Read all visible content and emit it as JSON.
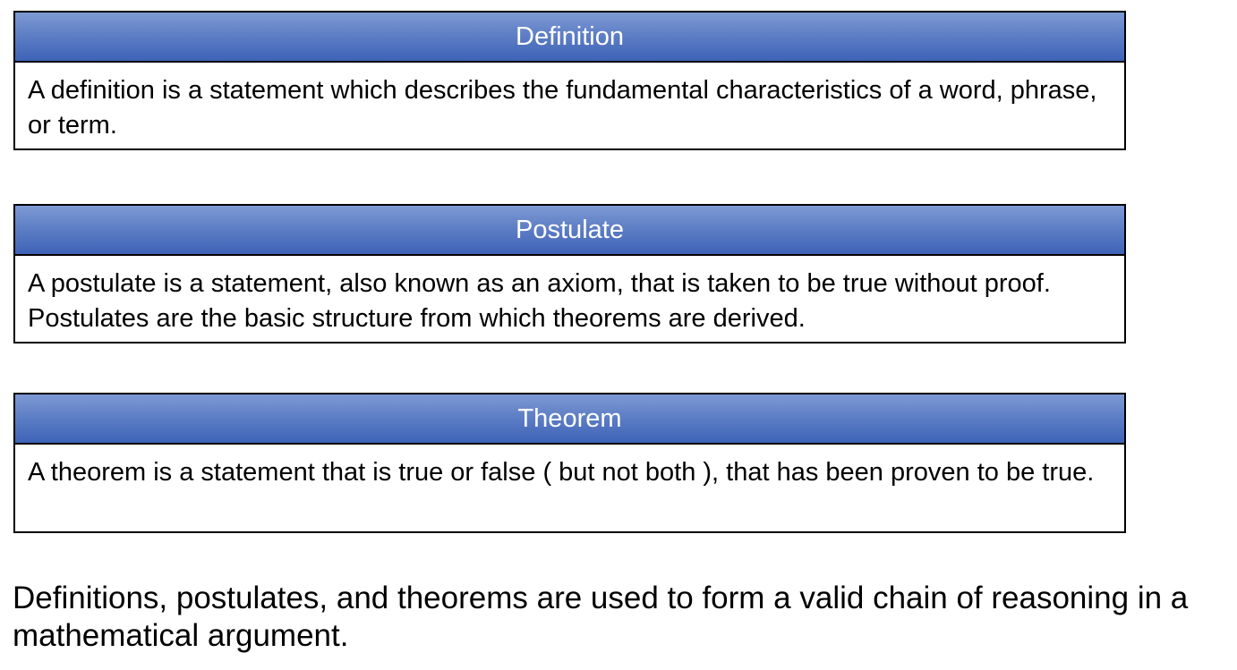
{
  "cards": [
    {
      "title": "Definition",
      "body": "A definition is a statement which describes the fundamental characteristics of a word, phrase, or term."
    },
    {
      "title": "Postulate",
      "body": "A postulate is a statement, also known as an axiom, that is taken to be true without proof.  Postulates are the basic structure from which theorems are derived."
    },
    {
      "title": "Theorem",
      "body": "A theorem is a statement that is true or false ( but not both ), that has been proven to be true."
    }
  ],
  "summary": "Definitions, postulates, and theorems are used to form a valid chain of reasoning in a mathematical argument.",
  "colors": {
    "header_gradient_top": "#7e9ad4",
    "header_gradient_bottom": "#3e63b6",
    "header_text": "#ffffff",
    "border": "#000000"
  }
}
